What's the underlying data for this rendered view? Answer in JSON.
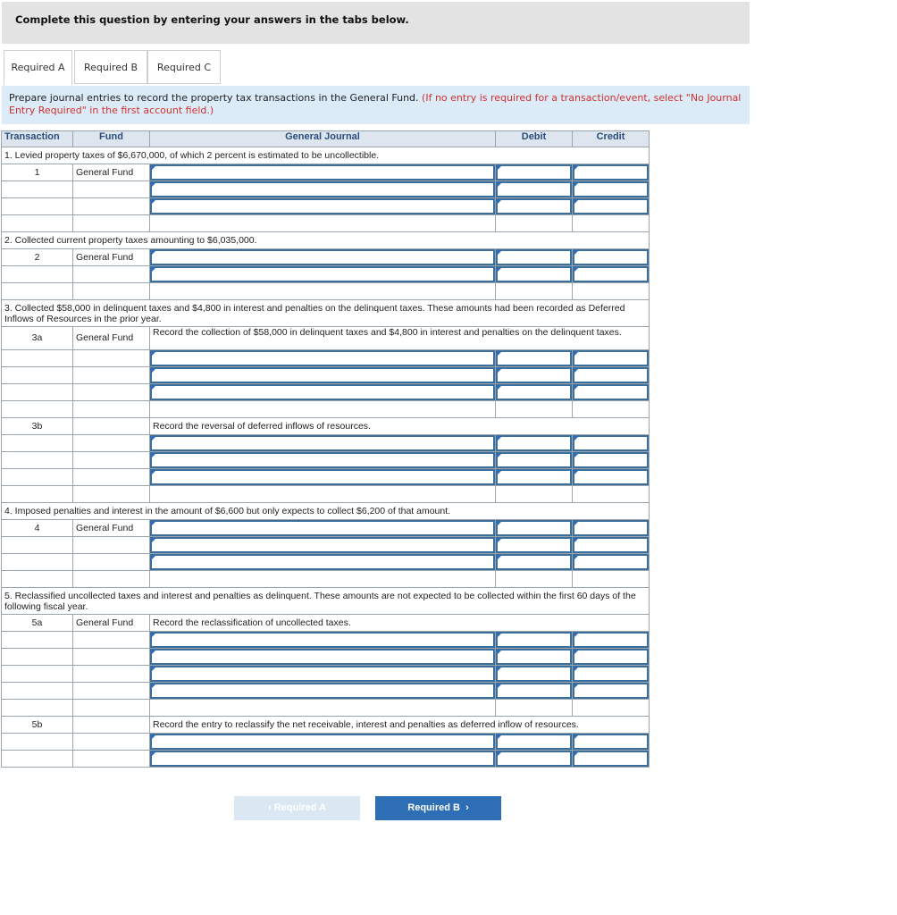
{
  "header": {
    "title": "Complete this question by entering your answers in the tabs below."
  },
  "tabs": [
    {
      "label": "Required A"
    },
    {
      "label": "Required B"
    },
    {
      "label": "Required C"
    }
  ],
  "instructions": {
    "text": "Prepare journal entries to record the property tax transactions in the General Fund.",
    "note": "(If no entry is required for a transaction/event, select \"No Journal Entry Required\" in the first account field.)"
  },
  "table": {
    "headers": [
      "Transaction",
      "Fund",
      "General Journal",
      "Debit",
      "Credit"
    ],
    "sections": [
      {
        "description": "1. Levied property taxes of $6,670,000, of which 2 percent is estimated to be uncollectible."
      },
      {
        "description": "2. Collected current property taxes amounting to $6,035,000."
      },
      {
        "description": "3. Collected $58,000 in delinquent taxes and $4,800 in interest and penalties on the delinquent taxes. These amounts had been recorded as Deferred Inflows of Resources in the prior year."
      },
      {
        "description": "4. Imposed penalties and interest in the amount of $6,600 but only expects to collect $6,200 of that amount."
      },
      {
        "description": "5. Reclassified uncollected taxes and interest and penalties as delinquent. These amounts are not expected to be collected within the first 60 days of the following fiscal year."
      }
    ],
    "entries": {
      "e1": {
        "transaction": "1",
        "fund": "General Fund"
      },
      "e2": {
        "transaction": "2",
        "fund": "General Fund"
      },
      "e3a": {
        "transaction": "3a",
        "fund": "General Fund",
        "memo": "Record the collection of $58,000 in delinquent taxes and $4,800 in interest and penalties on the delinquent taxes."
      },
      "e3b": {
        "transaction": "3b",
        "memo": "Record the reversal of deferred inflows of resources."
      },
      "e4": {
        "transaction": "4",
        "fund": "General Fund"
      },
      "e5a": {
        "transaction": "5a",
        "fund": "General Fund",
        "memo": "Record the reclassification of uncollected taxes."
      },
      "e5b": {
        "transaction": "5b",
        "memo": "Record the entry to reclassify the net receivable, interest and penalties as deferred inflow of resources."
      }
    }
  },
  "navigation": {
    "prev_label": "Required A",
    "next_label": "Required B",
    "prev_icon": "chevron-left-icon",
    "next_icon": "chevron-right-icon"
  }
}
